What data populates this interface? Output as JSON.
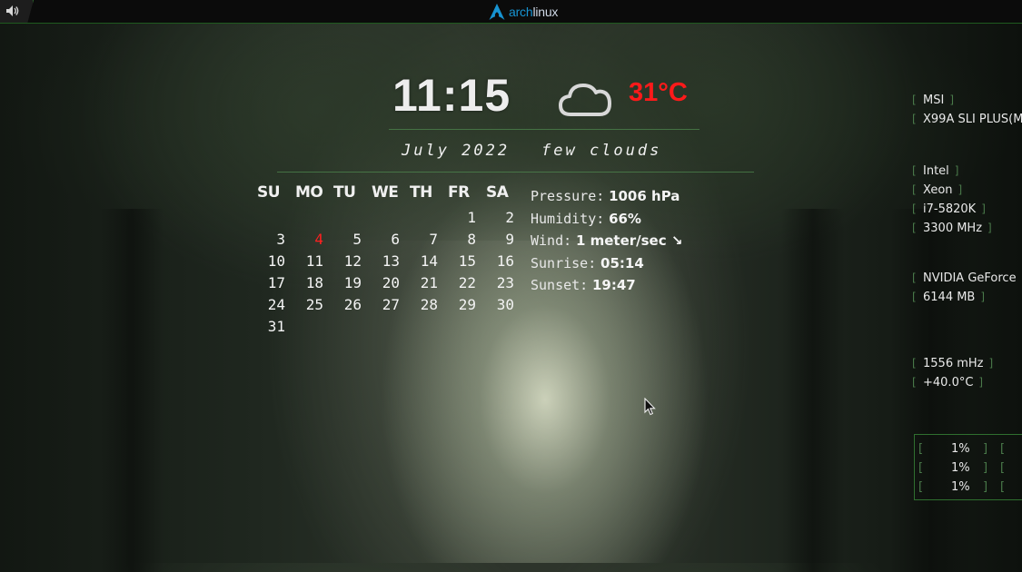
{
  "topbar": {
    "logo_prefix": "arch",
    "logo_suffix": "linux",
    "tray_icon": "speaker-icon"
  },
  "clock": {
    "time": "11:15"
  },
  "weather": {
    "icon": "cloud-icon",
    "temperature": "31°C",
    "temperature_color": "#ff1a1a",
    "condition": "few clouds",
    "details": [
      {
        "label": "Pressure:",
        "value": "1006 hPa"
      },
      {
        "label": "Humidity:",
        "value": "66%"
      },
      {
        "label": "Wind:",
        "value": "1 meter/sec ↘"
      },
      {
        "label": "Sunrise:",
        "value": "05:14"
      },
      {
        "label": "Sunset:",
        "value": "19:47"
      }
    ]
  },
  "calendar": {
    "month_label": "July 2022",
    "weekdays": [
      "SU",
      "MO",
      "TU",
      "WE",
      "TH",
      "FR",
      "SA"
    ],
    "today": "4",
    "today_color": "#ff2020",
    "weeks": [
      [
        "",
        "",
        "",
        "",
        "",
        "1",
        "2"
      ],
      [
        "3",
        "4",
        "5",
        "6",
        "7",
        "8",
        "9"
      ],
      [
        "10",
        "11",
        "12",
        "13",
        "14",
        "15",
        "16"
      ],
      [
        "17",
        "18",
        "19",
        "20",
        "21",
        "22",
        "23"
      ],
      [
        "24",
        "25",
        "26",
        "27",
        "28",
        "29",
        "30"
      ],
      [
        "31",
        "",
        "",
        "",
        "",
        "",
        ""
      ]
    ]
  },
  "system": {
    "motherboard": [
      "MSI",
      "X99A SLI PLUS(M"
    ],
    "cpu": [
      "Intel",
      "Xeon",
      "i7-5820K",
      "3300 MHz"
    ],
    "gpu": [
      "NVIDIA GeForce",
      "6144 MB"
    ],
    "gpu_stats": [
      "1556 mHz",
      "+40.0°C"
    ],
    "cpu_usage": [
      "1%",
      "1%",
      "1%"
    ]
  }
}
